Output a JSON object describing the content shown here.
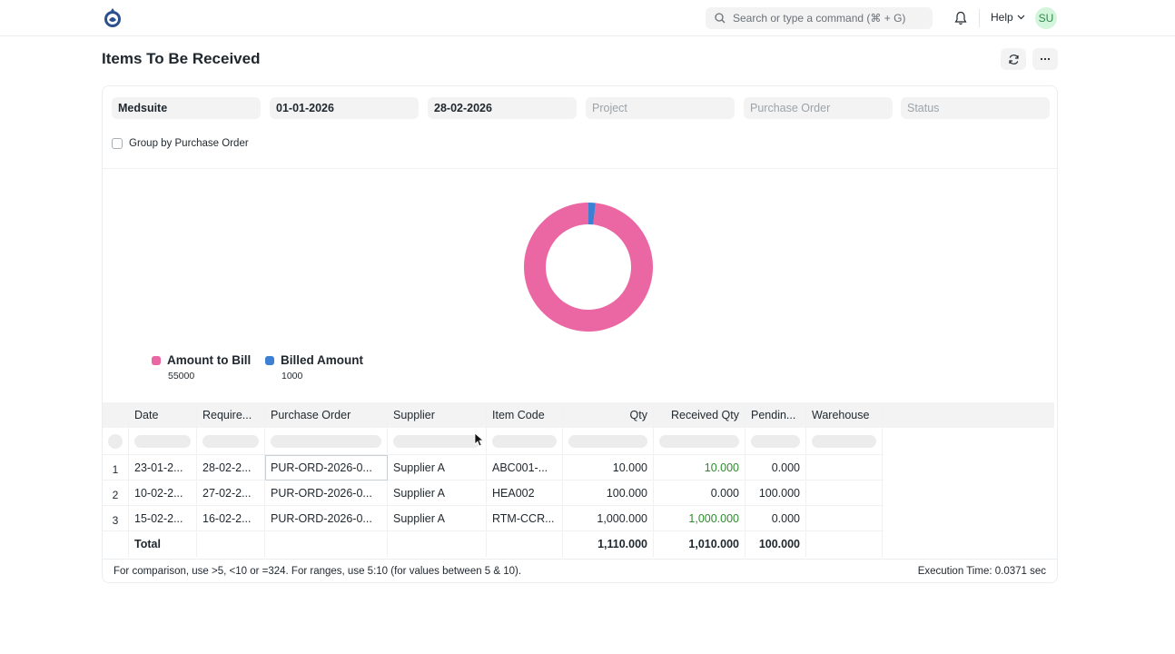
{
  "navbar": {
    "search_placeholder": "Search or type a command (⌘ + G)",
    "help_label": "Help",
    "avatar_initials": "SU"
  },
  "page": {
    "title": "Items To Be Received"
  },
  "filters": {
    "company": "Medsuite",
    "from_date": "01-01-2026",
    "to_date": "28-02-2026",
    "project_placeholder": "Project",
    "purchase_order_placeholder": "Purchase Order",
    "status_placeholder": "Status",
    "group_by_label": "Group by Purchase Order",
    "group_by_checked": false
  },
  "chart_data": {
    "type": "pie",
    "donut": true,
    "categories": [
      "Amount to Bill",
      "Billed Amount"
    ],
    "values": [
      55000,
      1000
    ],
    "colors": [
      "#ea67a4",
      "#3d7fd2"
    ],
    "value_labels": [
      "55000",
      "1000"
    ],
    "legend_placement": "bottom-left"
  },
  "table": {
    "columns": [
      "Date",
      "Require...",
      "Purchase Order",
      "Supplier",
      "Item Code",
      "Qty",
      "Received Qty",
      "Pendin...",
      "Warehouse"
    ],
    "rows": [
      {
        "num": "1",
        "date": "23-01-2...",
        "required": "28-02-2...",
        "po": "PUR-ORD-2026-0...",
        "supplier": "Supplier A",
        "item_code": "ABC001-...",
        "qty": "10.000",
        "received_qty": "10.000",
        "pending": "0.000",
        "warehouse": ""
      },
      {
        "num": "2",
        "date": "10-02-2...",
        "required": "27-02-2...",
        "po": "PUR-ORD-2026-0...",
        "supplier": "Supplier A",
        "item_code": "HEA002",
        "qty": "100.000",
        "received_qty": "0.000",
        "pending": "100.000",
        "warehouse": ""
      },
      {
        "num": "3",
        "date": "15-02-2...",
        "required": "16-02-2...",
        "po": "PUR-ORD-2026-0...",
        "supplier": "Supplier A",
        "item_code": "RTM-CCR...",
        "qty": "1,000.000",
        "received_qty": "1,000.000",
        "pending": "0.000",
        "warehouse": ""
      }
    ],
    "total": {
      "label": "Total",
      "qty": "1,110.000",
      "received_qty": "1,010.000",
      "pending": "100.000"
    }
  },
  "footer": {
    "hint": "For comparison, use >5, <10 or =324. For ranges, use 5:10 (for values between 5 & 10).",
    "execution_time": "Execution Time: 0.0371 sec"
  }
}
